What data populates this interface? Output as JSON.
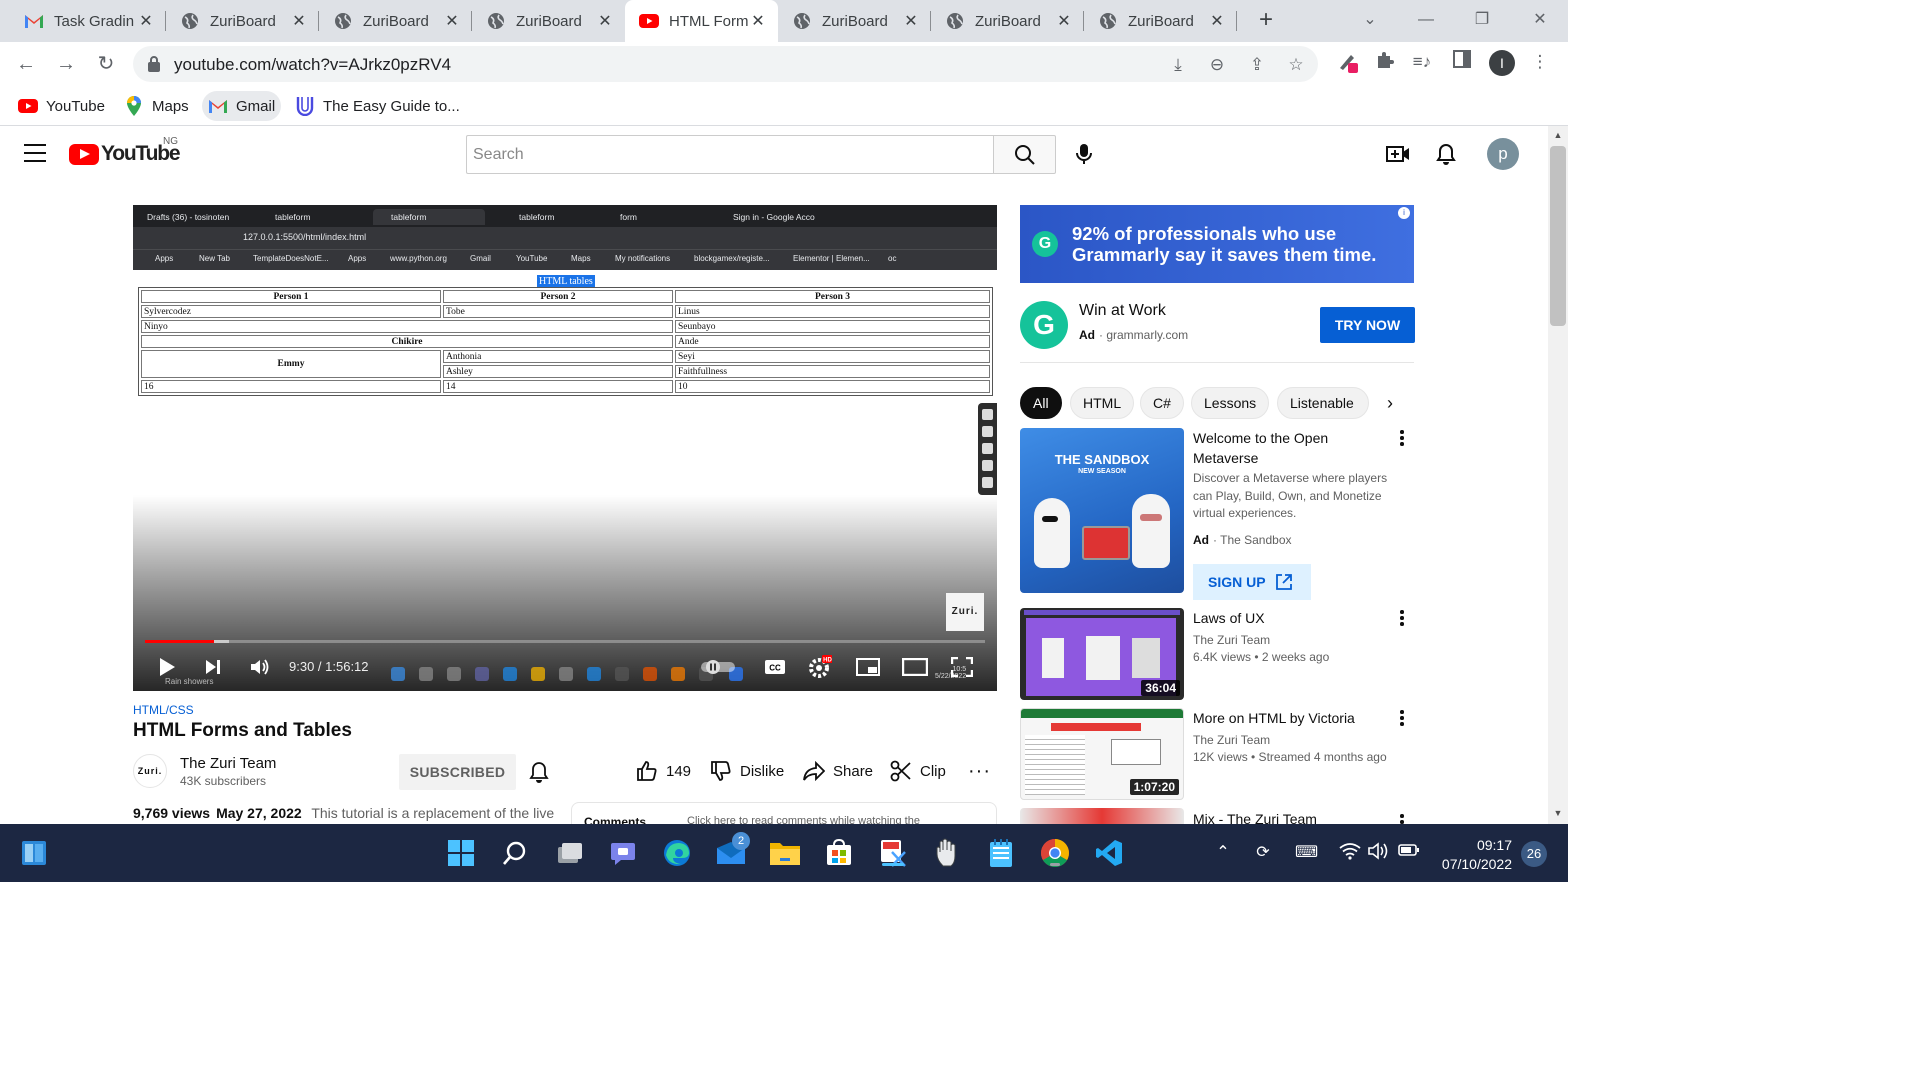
{
  "browser": {
    "tabs": [
      {
        "label": "Task Gradin",
        "icon": "gmail-icon"
      },
      {
        "label": "ZuriBoard",
        "icon": "globe-icon"
      },
      {
        "label": "ZuriBoard",
        "icon": "globe-icon"
      },
      {
        "label": "ZuriBoard",
        "icon": "globe-icon"
      },
      {
        "label": "HTML Form",
        "icon": "youtube-icon",
        "active": true
      },
      {
        "label": "ZuriBoard",
        "icon": "globe-icon"
      },
      {
        "label": "ZuriBoard",
        "icon": "globe-icon"
      },
      {
        "label": "ZuriBoard",
        "icon": "globe-icon"
      }
    ],
    "url": "youtube.com/watch?v=AJrkz0pzRV4",
    "profile_initial": "I",
    "bookmarks": [
      {
        "label": "YouTube",
        "icon": "youtube-icon"
      },
      {
        "label": "Maps",
        "icon": "maps-pin-icon"
      },
      {
        "label": "Gmail",
        "icon": "gmail-icon"
      },
      {
        "label": "The Easy Guide to...",
        "icon": "u-logo-icon"
      }
    ]
  },
  "youtube": {
    "logo_text": "YouTube",
    "region": "NG",
    "search_placeholder": "Search",
    "avatar_initial": "p"
  },
  "video_frame": {
    "inner_tabs": [
      "Drafts (36) - tosinoten",
      "tableform",
      "tableform",
      "tableform",
      "form",
      "Sign in - Google Acco"
    ],
    "inner_url": "127.0.0.1:5500/html/index.html",
    "inner_bookmarks": [
      "Apps",
      "New Tab",
      "TemplateDoesNotE...",
      "Apps",
      "www.python.org",
      "Gmail",
      "YouTube",
      "Maps",
      "My notifications",
      "blockgamex/registe...",
      "Elementor | Elemen...",
      "oc"
    ],
    "caption": "HTML tables",
    "table": {
      "headers": [
        "Person 1",
        "Person 2",
        "Person 3"
      ],
      "r1": [
        "Sylvercodez",
        "Tobe",
        "Linus"
      ],
      "r2": [
        "Ninyo",
        "Seunbayo"
      ],
      "r3": [
        "Chikire",
        "Ande"
      ],
      "emmy": "Emmy",
      "r4": [
        "Anthonia",
        "Seyi"
      ],
      "r5": [
        "Ashley",
        "Faithfullness"
      ],
      "r6": [
        "16",
        "14",
        "10"
      ]
    },
    "watermark": "Zuri.",
    "weather": "Rain showers",
    "ghost_time": "10:5",
    "ghost_date": "5/22/2022"
  },
  "player": {
    "time": "9:30 / 1:56:12",
    "progress_fraction": 0.0817,
    "buffer_fraction": 0.1
  },
  "video": {
    "tag": "HTML/CSS",
    "title": "HTML Forms and Tables",
    "channel": "The Zuri Team",
    "channel_avatar": "Zuri.",
    "subscribers": "43K subscribers",
    "subscribe_label": "SUBSCRIBED",
    "likes": "149",
    "dislike_label": "Dislike",
    "share_label": "Share",
    "clip_label": "Clip",
    "views": "9,769 views",
    "date": "May 27, 2022",
    "description": "This tutorial is a replacement of the live",
    "comments_label": "Comments",
    "comments_hint": "Click here to read comments while watching the"
  },
  "ad": {
    "banner_text": "92% of professionals who use Grammarly say it saves them time.",
    "banner_line1": "92% of professionals who use",
    "banner_line2": "Grammarly say it saves them time.",
    "logo_letter": "G",
    "card_title": "Win at Work",
    "ad_label": "Ad",
    "domain": "· grammarly.com",
    "cta": "TRY NOW"
  },
  "chips": [
    "All",
    "HTML",
    "C#",
    "Lessons",
    "Listenable"
  ],
  "recommendations": [
    {
      "title": "Welcome to the Open Metaverse",
      "description": "Discover a Metaverse where players can Play, Build, Own, and Monetize virtual experiences.",
      "ad_label": "Ad",
      "channel": "· The Sandbox",
      "cta": "SIGN UP",
      "thumb_text": "THE SANDBOX",
      "thumb_sub": "NEW SEASON"
    },
    {
      "title": "Laws of UX",
      "channel": "The Zuri Team",
      "meta": "6.4K views • 2 weeks ago",
      "duration": "36:04"
    },
    {
      "title": "More on HTML by Victoria",
      "channel": "The Zuri Team",
      "meta": "12K views • Streamed 4 months ago",
      "duration": "1:07:20"
    },
    {
      "title": "Mix - The Zuri Team"
    }
  ],
  "taskbar": {
    "time": "09:17",
    "date": "07/10/2022",
    "mail_badge": "2",
    "notifications": "26"
  }
}
